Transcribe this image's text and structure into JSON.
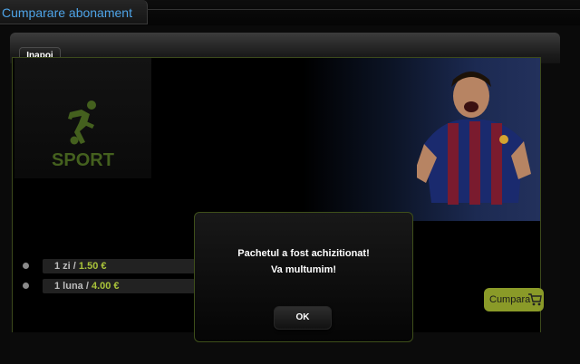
{
  "window": {
    "tab_title": "Cumparare abonament"
  },
  "toolbar": {
    "back_label": "Inapoi"
  },
  "package": {
    "category_label": "SPORT",
    "category_icon": "soccer-player-icon",
    "prices": [
      {
        "duration": "1 zi",
        "separator": " / ",
        "price": "1.50 €"
      },
      {
        "duration": "1 luna",
        "separator": " / ",
        "price": "4.00 €"
      }
    ],
    "buy_label": "Cumpara",
    "buy_icon": "shopping-cart-icon"
  },
  "dialog": {
    "message_line1": "Pachetul a fost achizitionat!",
    "message_line2": "Va multumim!",
    "ok_label": "OK"
  },
  "colors": {
    "accent_green": "#a9c33a",
    "tab_title_blue": "#4ea4e8",
    "buy_button": "#8a9a28"
  }
}
